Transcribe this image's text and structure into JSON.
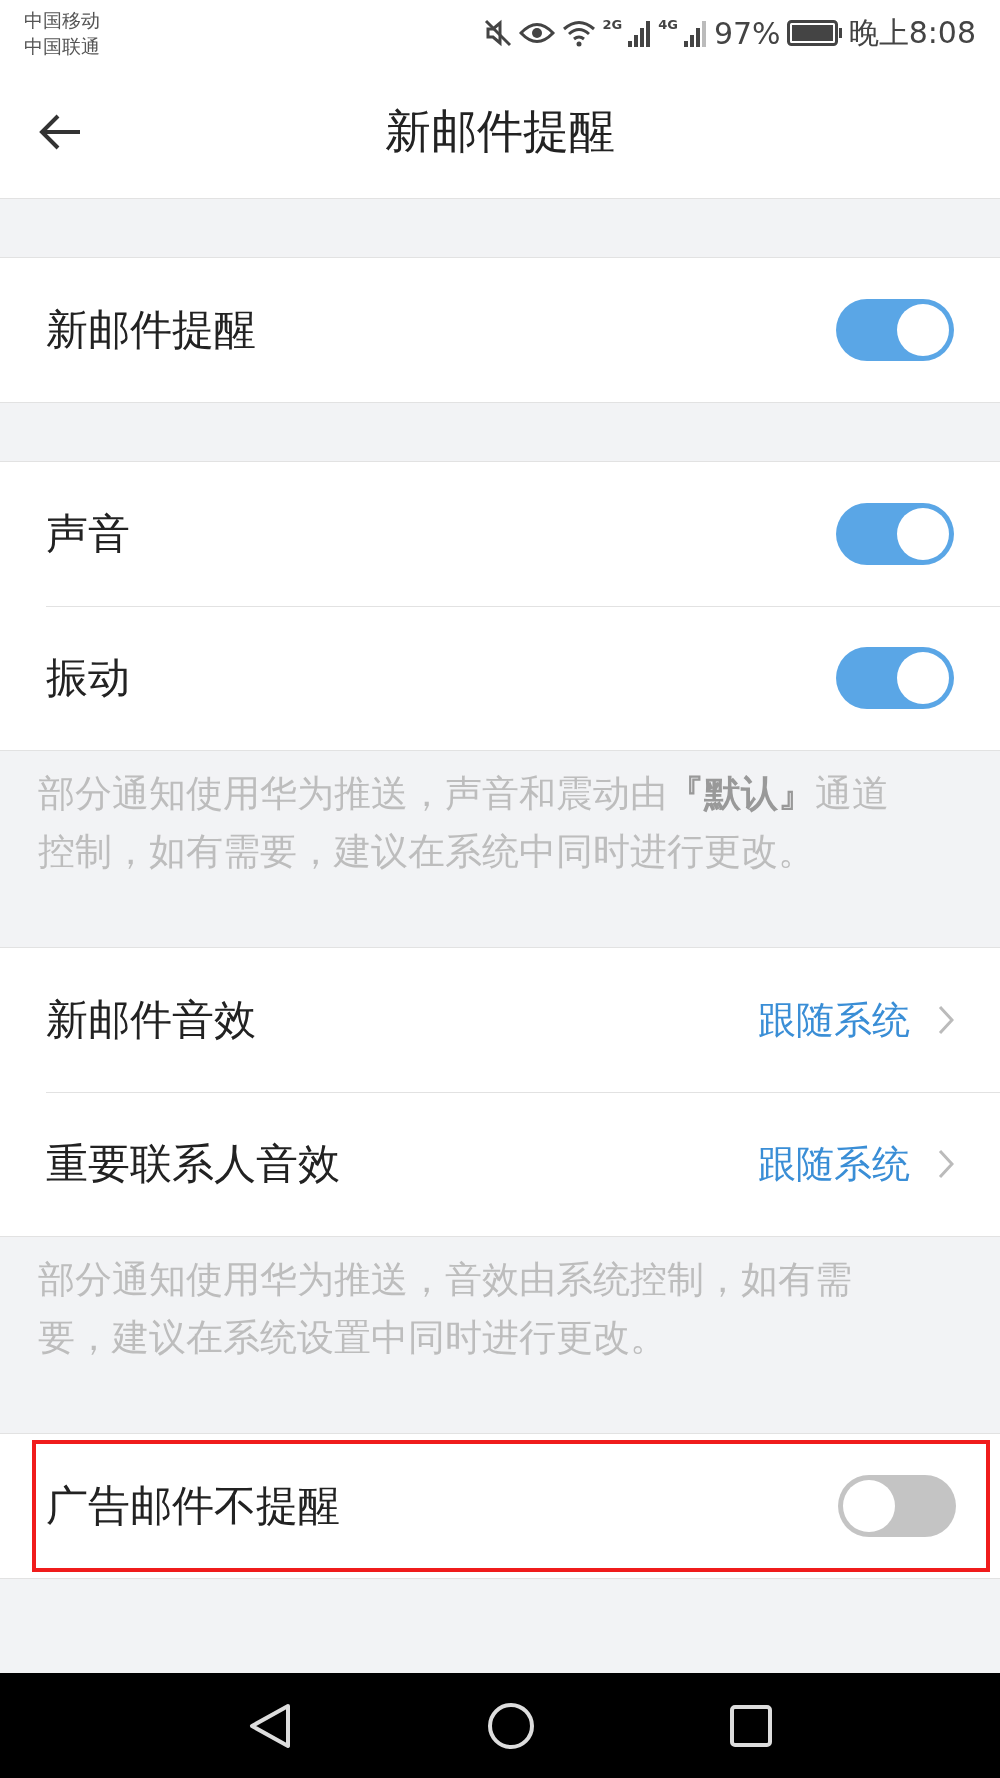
{
  "status_bar": {
    "carriers": [
      "中国移动",
      "中国联通"
    ],
    "network_2g": "2G",
    "network_4g": "4G",
    "battery": "97%",
    "time": "晚上8:08"
  },
  "header": {
    "title": "新邮件提醒"
  },
  "sections": [
    {
      "rows": [
        {
          "kind": "toggle",
          "label": "新邮件提醒",
          "on": true,
          "highlighted": false
        }
      ]
    },
    {
      "rows": [
        {
          "kind": "toggle",
          "label": "声音",
          "on": true,
          "highlighted": false
        },
        {
          "kind": "toggle",
          "label": "振动",
          "on": true,
          "highlighted": false
        }
      ],
      "note": "部分通知使用华为推送，声音和震动由**『默认』**通道控制，如有需要，建议在系统中同时进行更改。"
    },
    {
      "rows": [
        {
          "kind": "link",
          "label": "新邮件音效",
          "value": "跟随系统",
          "highlighted": false
        },
        {
          "kind": "link",
          "label": "重要联系人音效",
          "value": "跟随系统",
          "highlighted": false
        }
      ],
      "note": "部分通知使用华为推送，音效由系统控制，如有需要，建议在系统设置中同时进行更改。"
    },
    {
      "rows": [
        {
          "kind": "toggle",
          "label": "广告邮件不提醒",
          "on": false,
          "highlighted": true
        }
      ]
    }
  ]
}
